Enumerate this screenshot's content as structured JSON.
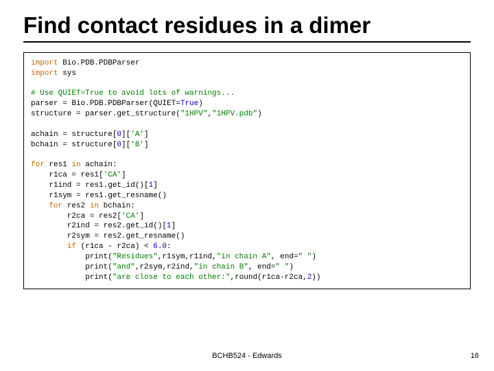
{
  "title": "Find contact residues in a dimer",
  "code": {
    "l1a": "import",
    "l1b": " Bio.PDB.PDBParser",
    "l2a": "import",
    "l2b": " sys",
    "l4": "# Use QUIET=True to avoid lots of warnings...",
    "l5a": "parser = Bio.PDB.PDBParser(QUIET=",
    "l5b": "True",
    "l5c": ")",
    "l6a": "structure = parser.get_structure(",
    "l6b": "\"1HPV\"",
    "l6c": ",",
    "l6d": "\"1HPV.pdb\"",
    "l6e": ")",
    "l8a": "achain = structure[",
    "l8b": "0",
    "l8c": "][",
    "l8d": "'A'",
    "l8e": "]",
    "l9a": "bchain = structure[",
    "l9b": "0",
    "l9c": "][",
    "l9d": "'B'",
    "l9e": "]",
    "l11a": "for",
    "l11b": " res1 ",
    "l11c": "in",
    "l11d": " achain:",
    "l12a": "    r1ca = res1[",
    "l12b": "'CA'",
    "l12c": "]",
    "l13a": "    r1ind = res1.get_id()[",
    "l13b": "1",
    "l13c": "]",
    "l14": "    r1sym = res1.get_resname()",
    "l15a": "    ",
    "l15b": "for",
    "l15c": " res2 ",
    "l15d": "in",
    "l15e": " bchain:",
    "l16a": "        r2ca = res2[",
    "l16b": "'CA'",
    "l16c": "]",
    "l17a": "        r2ind = res2.get_id()[",
    "l17b": "1",
    "l17c": "]",
    "l18": "        r2sym = res2.get_resname()",
    "l19a": "        ",
    "l19b": "if",
    "l19c": " (r1ca - r2ca) < ",
    "l19d": "6.0",
    "l19e": ":",
    "l20a": "            print(",
    "l20b": "\"Residues\"",
    "l20c": ",r1sym,r1ind,",
    "l20d": "\"in chain A\"",
    "l20e": ", end=",
    "l20f": "\" \"",
    "l20g": ")",
    "l21a": "            print(",
    "l21b": "\"and\"",
    "l21c": ",r2sym,r2ind,",
    "l21d": "\"in chain B\"",
    "l21e": ", end=",
    "l21f": "\" \"",
    "l21g": ")",
    "l22a": "            print(",
    "l22b": "\"are close to each other:\"",
    "l22c": ",round(r1ca-r2ca,",
    "l22d": "2",
    "l22e": "))"
  },
  "footer": "BCHB524 - Edwards",
  "page": "16"
}
